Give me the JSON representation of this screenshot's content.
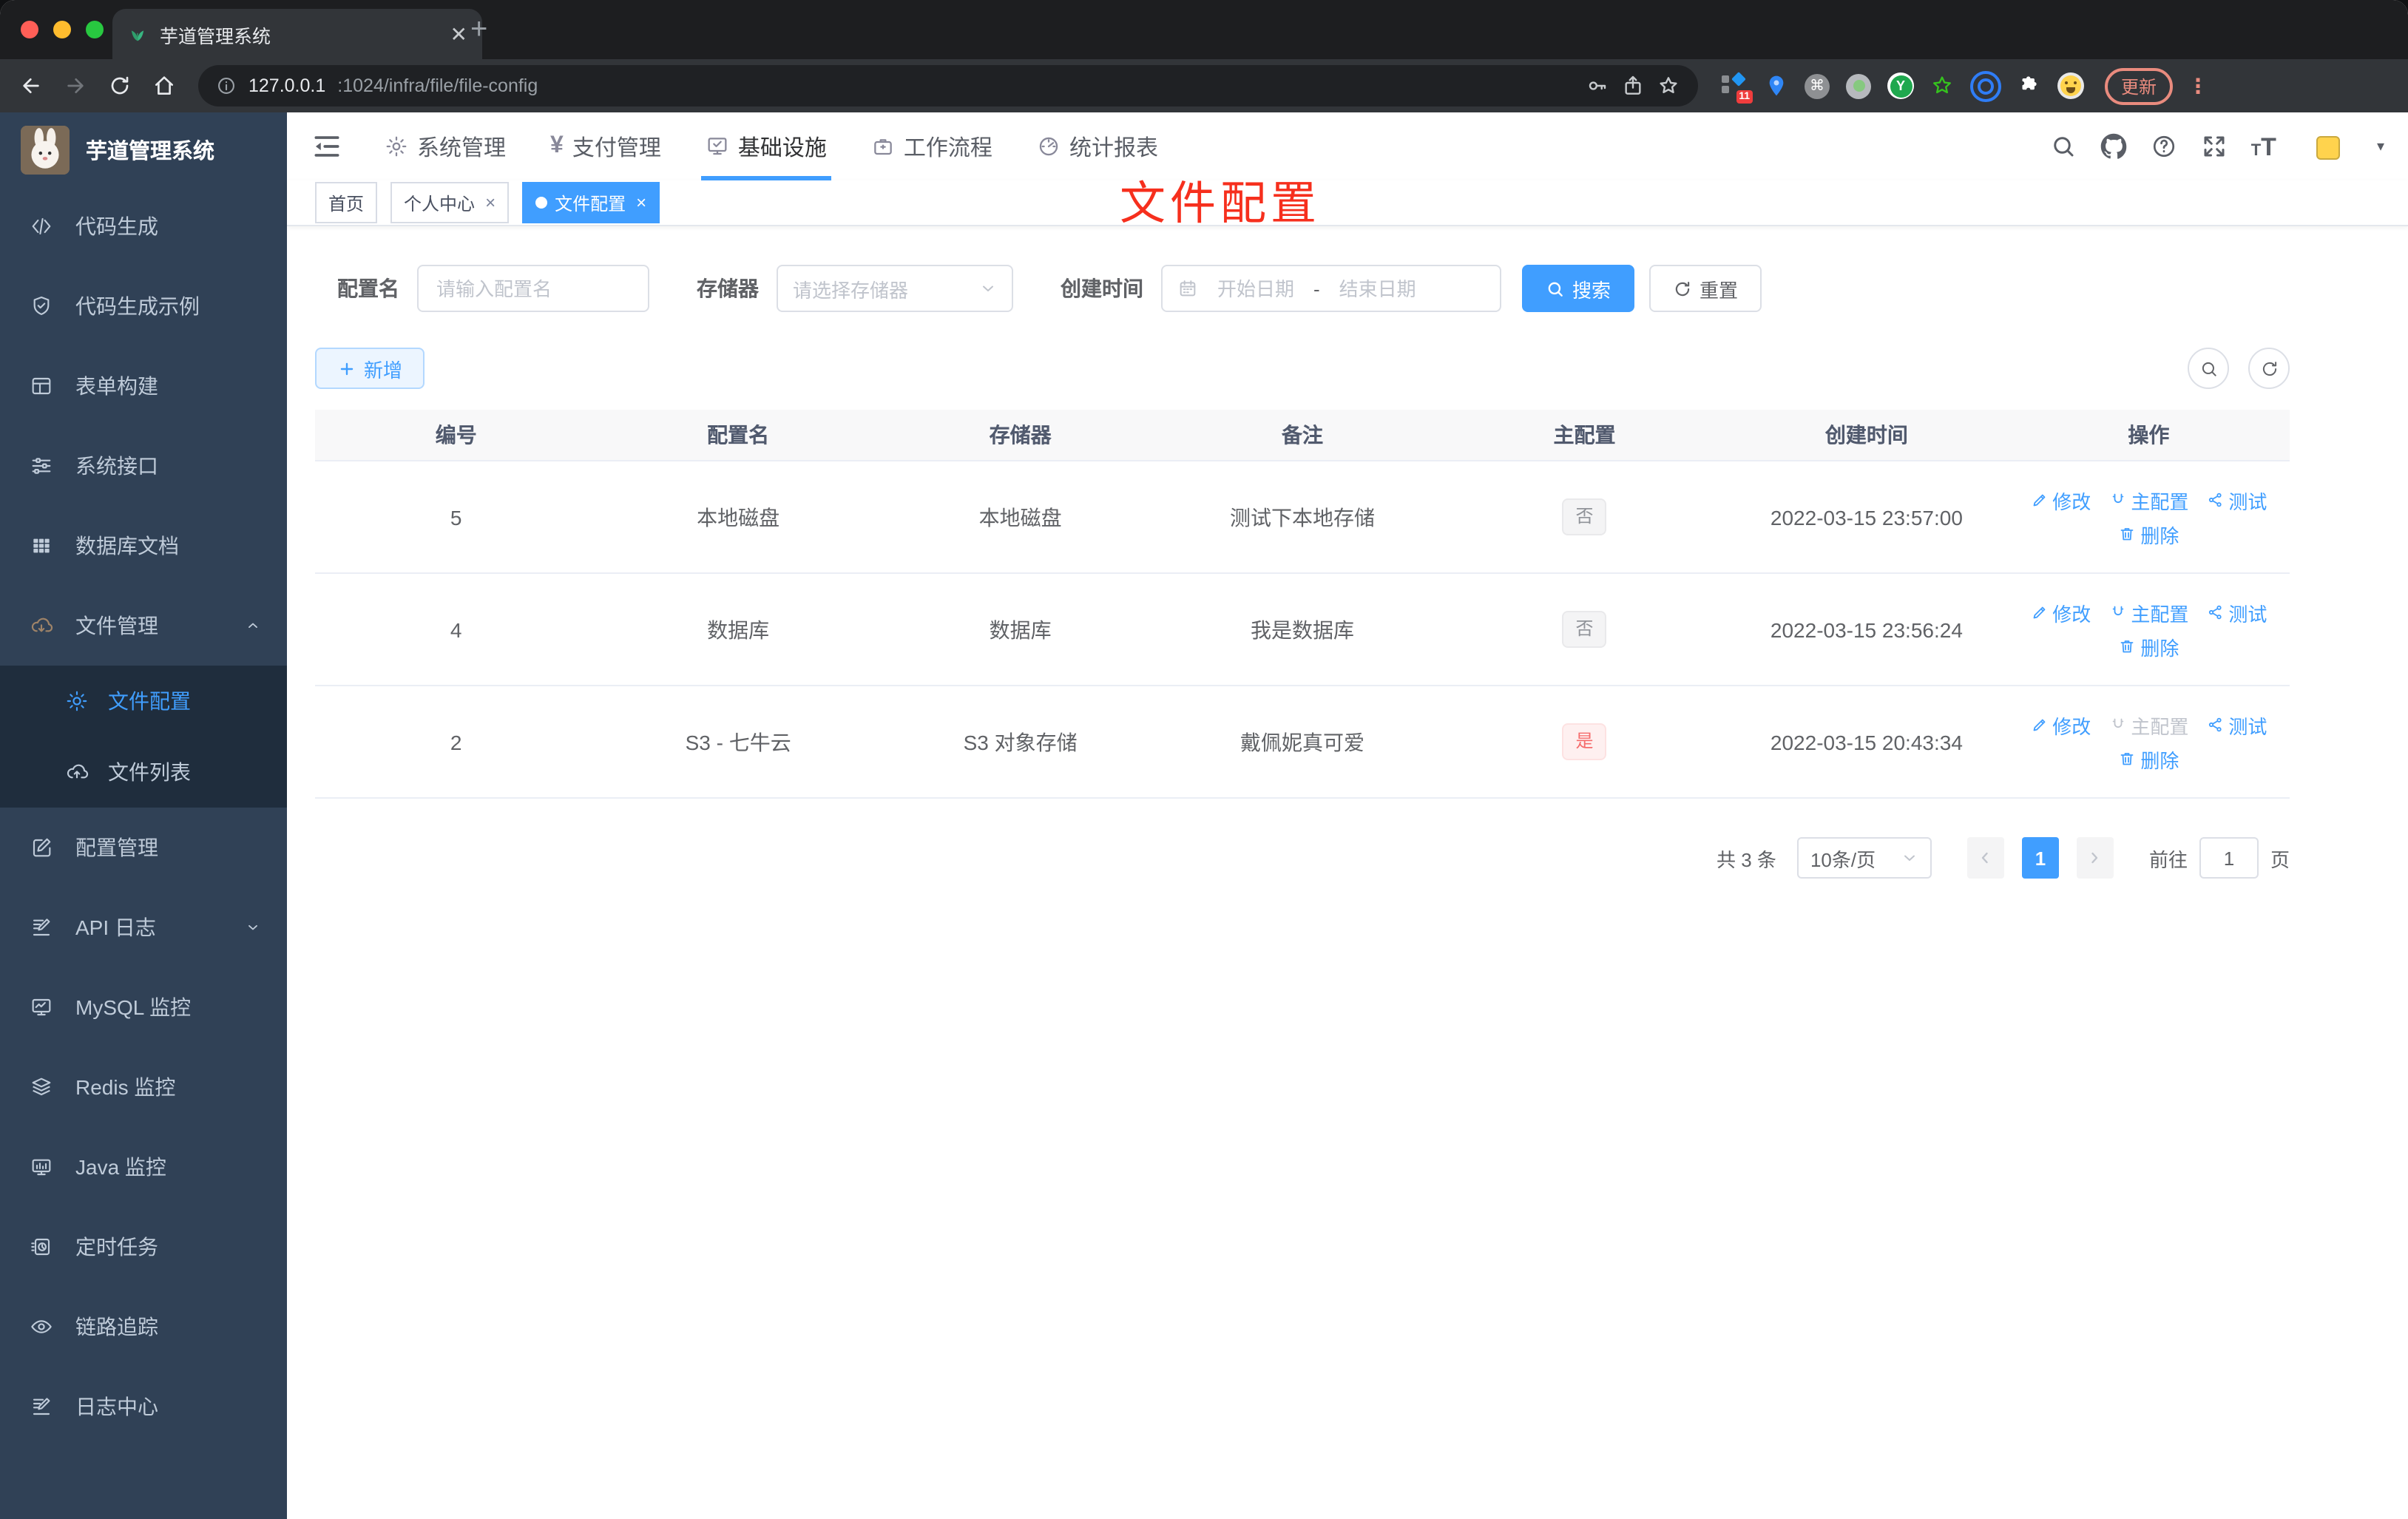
{
  "browser": {
    "tab_title": "芋道管理系统",
    "url_host": "127.0.0.1",
    "url_path": ":1024/infra/file/file-config",
    "ext_badge": "11",
    "ext_y": "Y",
    "cmd_glyph": "⌘",
    "update_label": "更新"
  },
  "sidebar": {
    "title": "芋道管理系统",
    "items": [
      {
        "label": "代码生成"
      },
      {
        "label": "代码生成示例"
      },
      {
        "label": "表单构建"
      },
      {
        "label": "系统接口"
      },
      {
        "label": "数据库文档"
      },
      {
        "label": "文件管理"
      },
      {
        "label": "文件配置"
      },
      {
        "label": "文件列表"
      },
      {
        "label": "配置管理"
      },
      {
        "label": "API 日志"
      },
      {
        "label": "MySQL 监控"
      },
      {
        "label": "Redis 监控"
      },
      {
        "label": "Java 监控"
      },
      {
        "label": "定时任务"
      },
      {
        "label": "链路追踪"
      },
      {
        "label": "日志中心"
      }
    ]
  },
  "header": {
    "menus": [
      {
        "label": "系统管理"
      },
      {
        "label": "支付管理"
      },
      {
        "label": "基础设施"
      },
      {
        "label": "工作流程"
      },
      {
        "label": "统计报表"
      }
    ],
    "yen_glyph": "¥",
    "font_icon_letter": "T"
  },
  "tags": [
    {
      "label": "首页"
    },
    {
      "label": "个人中心"
    },
    {
      "label": "文件配置"
    }
  ],
  "annotation": {
    "text": "文件配置"
  },
  "filters": {
    "config_name_label": "配置名",
    "config_name_placeholder": "请输入配置名",
    "storage_label": "存储器",
    "storage_placeholder": "请选择存储器",
    "create_time_label": "创建时间",
    "start_placeholder": "开始日期",
    "separator": "-",
    "end_placeholder": "结束日期",
    "search_label": "搜索",
    "reset_label": "重置"
  },
  "toolbar": {
    "add_label": "新增"
  },
  "table": {
    "columns": [
      "编号",
      "配置名",
      "存储器",
      "备注",
      "主配置",
      "创建时间",
      "操作"
    ],
    "actions": {
      "edit": "修改",
      "master": "主配置",
      "test": "测试",
      "del": "删除"
    },
    "rows": [
      {
        "id": "5",
        "name": "本地磁盘",
        "storage": "本地磁盘",
        "remark": "测试下本地存储",
        "master": "否",
        "created": "2022-03-15 23:57:00"
      },
      {
        "id": "4",
        "name": "数据库",
        "storage": "数据库",
        "remark": "我是数据库",
        "master": "否",
        "created": "2022-03-15 23:56:24"
      },
      {
        "id": "2",
        "name": "S3 - 七牛云",
        "storage": "S3 对象存储",
        "remark": "戴佩妮真可爱",
        "master": "是",
        "created": "2022-03-15 20:43:34"
      }
    ]
  },
  "pagination": {
    "total": "共 3 条",
    "size": "10条/页",
    "page": "1",
    "goto_label": "前往",
    "goto_value": "1",
    "unit": "页"
  }
}
